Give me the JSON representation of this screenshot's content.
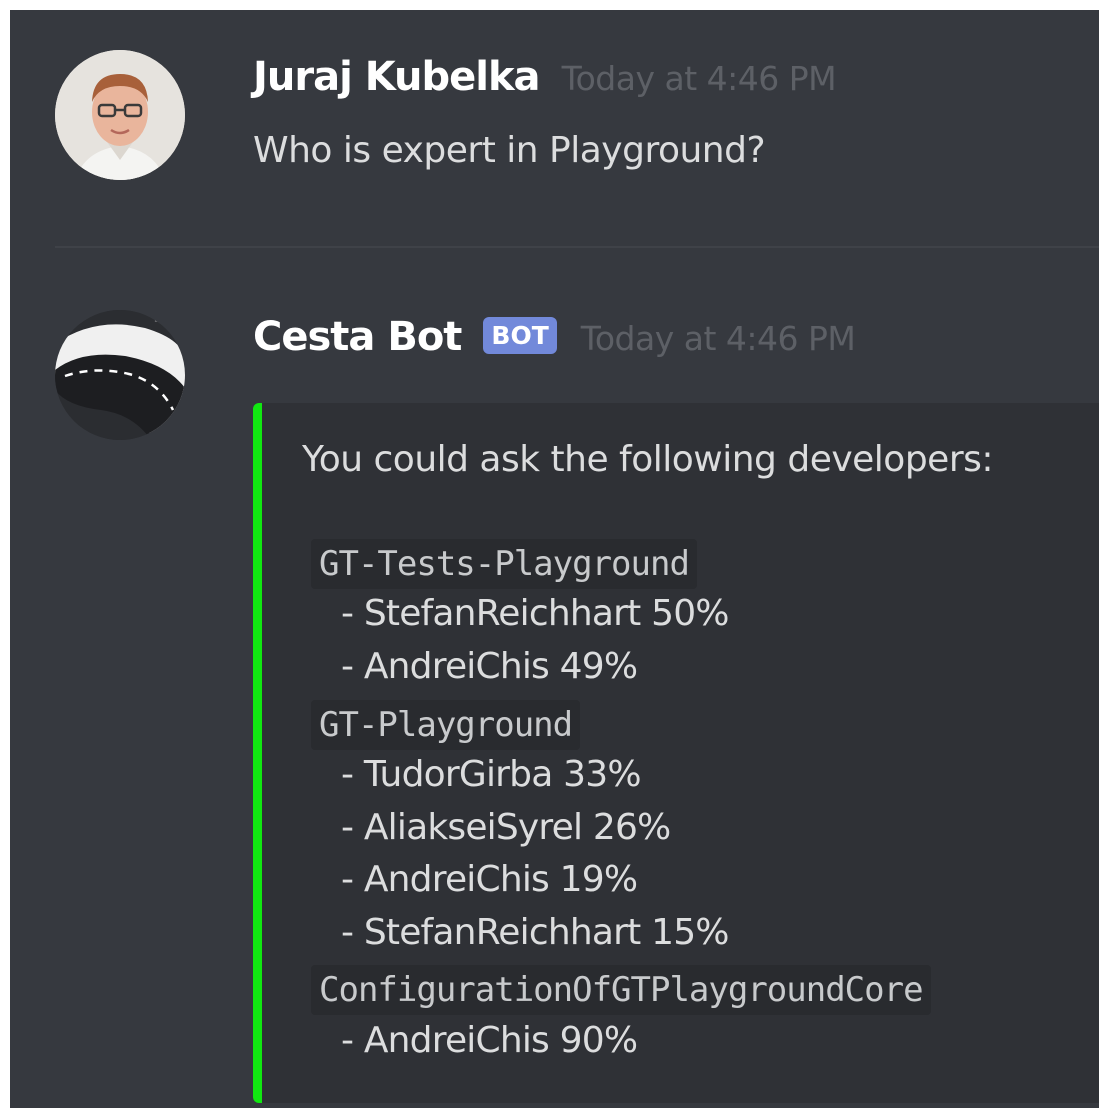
{
  "messages": [
    {
      "author": "Juraj Kubelka",
      "timestamp": "Today at 4:46 PM",
      "text": "Who is expert in Playground?",
      "avatar": "user-photo"
    },
    {
      "author": "Cesta Bot",
      "badge": "BOT",
      "timestamp": "Today at 4:46 PM",
      "avatar": "road-logo",
      "embed": {
        "accent_color": "#11e811",
        "intro": "You could ask the following developers:",
        "groups": [
          {
            "name": "GT-Tests-Playground",
            "developers": [
              "- StefanReichhart 50%",
              "- AndreiChis 49%"
            ]
          },
          {
            "name": "GT-Playground",
            "developers": [
              "- TudorGirba 33%",
              "- AliakseiSyrel 26%",
              "- AndreiChis 19%",
              "- StefanReichhart 15%"
            ]
          },
          {
            "name": "ConfigurationOfGTPlaygroundCore",
            "developers": [
              "- AndreiChis 90%"
            ]
          }
        ]
      }
    }
  ],
  "colors": {
    "background": "#36393f",
    "embed_background": "#2f3136",
    "bot_badge": "#7289da",
    "username": "#ffffff",
    "timestamp": "#5d6066"
  }
}
